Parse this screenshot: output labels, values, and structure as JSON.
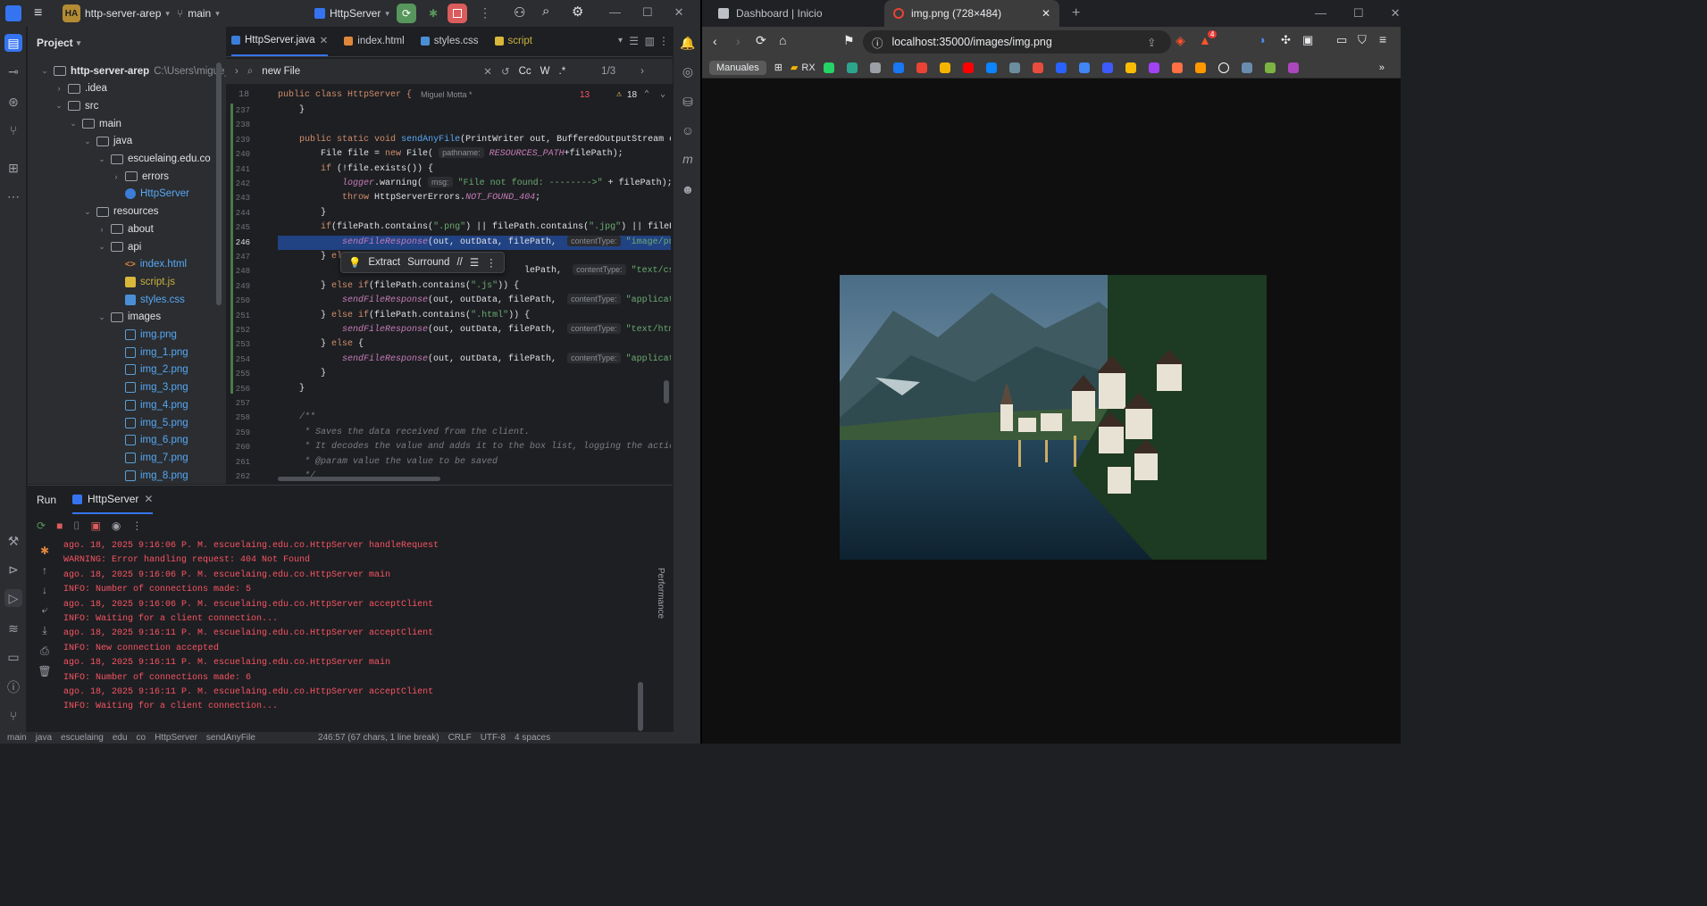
{
  "ide": {
    "project_badge": "HA",
    "project_name": "http-server-arep",
    "branch": "main",
    "run_config": "HttpServer",
    "project_panel_title": "Project",
    "tree": [
      {
        "label": "http-server-arep",
        "suffix": "C:\\Users\\migue_7m",
        "indent": 0,
        "kind": "folder",
        "open": true
      },
      {
        "label": ".idea",
        "indent": 1,
        "kind": "folder",
        "open": false
      },
      {
        "label": "src",
        "indent": 1,
        "kind": "folder",
        "open": true
      },
      {
        "label": "main",
        "indent": 2,
        "kind": "folder",
        "open": true
      },
      {
        "label": "java",
        "indent": 3,
        "kind": "folder",
        "open": true
      },
      {
        "label": "escuelaing.edu.co",
        "indent": 4,
        "kind": "folder",
        "open": true
      },
      {
        "label": "errors",
        "indent": 5,
        "kind": "folder",
        "open": false
      },
      {
        "label": "HttpServer",
        "indent": 5,
        "kind": "java"
      },
      {
        "label": "resources",
        "indent": 3,
        "kind": "folder",
        "open": true
      },
      {
        "label": "about",
        "indent": 4,
        "kind": "folder",
        "open": false
      },
      {
        "label": "api",
        "indent": 4,
        "kind": "folder",
        "open": true
      },
      {
        "label": "index.html",
        "indent": 5,
        "kind": "html"
      },
      {
        "label": "script.js",
        "indent": 5,
        "kind": "js"
      },
      {
        "label": "styles.css",
        "indent": 5,
        "kind": "css"
      },
      {
        "label": "images",
        "indent": 4,
        "kind": "folder",
        "open": true
      },
      {
        "label": "img.png",
        "indent": 5,
        "kind": "img"
      },
      {
        "label": "img_1.png",
        "indent": 5,
        "kind": "img"
      },
      {
        "label": "img_2.png",
        "indent": 5,
        "kind": "img"
      },
      {
        "label": "img_3.png",
        "indent": 5,
        "kind": "img"
      },
      {
        "label": "img_4.png",
        "indent": 5,
        "kind": "img"
      },
      {
        "label": "img_5.png",
        "indent": 5,
        "kind": "img"
      },
      {
        "label": "img_6.png",
        "indent": 5,
        "kind": "img"
      },
      {
        "label": "img_7.png",
        "indent": 5,
        "kind": "img"
      },
      {
        "label": "img_8.png",
        "indent": 5,
        "kind": "img"
      }
    ],
    "tabs": [
      "HttpServer.java",
      "index.html",
      "styles.css",
      "script"
    ],
    "find": {
      "query": "new File",
      "match_case": "Cc",
      "words": "W",
      "regex": ".*",
      "count": "1/3"
    },
    "sticky_line": "18",
    "sticky_code": "public class HttpServer {",
    "sticky_author": "Miguel Motta *",
    "errors": "13",
    "warnings": "18",
    "code_lines": [
      {
        "n": "237",
        "html": "    }"
      },
      {
        "n": "238",
        "html": ""
      },
      {
        "n": "239",
        "html": "    <span class='kw'>public static void</span> <span class='fn'>sendAnyFile</span>(PrintWriter out, BufferedOutputStream ou"
      },
      {
        "n": "240",
        "html": "        File file = <span class='kw'>new</span> File( <span class='hint'>pathname:</span> <span class='it2'>RESOURCES_PATH</span>+filePath);"
      },
      {
        "n": "241",
        "html": "        <span class='kw'>if</span> (!file.exists()) {"
      },
      {
        "n": "242",
        "html": "            <span class='it2'>logger</span>.warning( <span class='hint'>msg:</span> <span class='st'>\"File not found: -------->\"</span> + filePath);"
      },
      {
        "n": "243",
        "html": "            <span class='kw'>throw</span> HttpServerErrors.<span class='it2'>NOT_FOUND_404</span>;"
      },
      {
        "n": "244",
        "html": "        }"
      },
      {
        "n": "245",
        "html": "        <span class='kw'>if</span>(filePath.contains(<span class='st'>\".png\"</span>) || filePath.contains(<span class='st'>\".jpg\"</span>) || filePat"
      },
      {
        "n": "246",
        "html": "            <span class='it2'>sendFileResponse</span>(out, outData, filePath,  <span class='hint'>contentType:</span> <span class='st'>\"image/png\"</span>)",
        "sel": true
      },
      {
        "n": "247",
        "html": "        } <span class='kw'>el</span>"
      },
      {
        "n": "248",
        "html": "                                              lePath,  <span class='hint'>contentType:</span> <span class='st'>\"text/css\"</span>);"
      },
      {
        "n": "249",
        "html": "        } <span class='kw'>else if</span>(filePath.contains(<span class='st'>\".js\"</span>)) {"
      },
      {
        "n": "250",
        "html": "            <span class='it2'>sendFileResponse</span>(out, outData, filePath,  <span class='hint'>contentType:</span> <span class='st'>\"applicatio</span>"
      },
      {
        "n": "251",
        "html": "        } <span class='kw'>else if</span>(filePath.contains(<span class='st'>\".html\"</span>)) {"
      },
      {
        "n": "252",
        "html": "            <span class='it2'>sendFileResponse</span>(out, outData, filePath,  <span class='hint'>contentType:</span> <span class='st'>\"text/html\"</span>)"
      },
      {
        "n": "253",
        "html": "        } <span class='kw'>else</span> {"
      },
      {
        "n": "254",
        "html": "            <span class='it2'>sendFileResponse</span>(out, outData, filePath,  <span class='hint'>contentType:</span> <span class='st'>\"applicatio</span>"
      },
      {
        "n": "255",
        "html": "        }"
      },
      {
        "n": "256",
        "html": "    }"
      },
      {
        "n": "257",
        "html": ""
      },
      {
        "n": "258",
        "html": "    <span class='cm'>/**</span>"
      },
      {
        "n": "259",
        "html": "<span class='cm'>     * Saves the data received from the client.</span>"
      },
      {
        "n": "260",
        "html": "<span class='cm'>     * It decodes the value and adds it to the box list, logging the action.</span>"
      },
      {
        "n": "261",
        "html": "<span class='cm'>     * @param value the value to be saved</span>"
      },
      {
        "n": "262",
        "html": "<span class='cm'>     */</span>"
      }
    ],
    "popup": {
      "extract": "Extract",
      "surround": "Surround",
      "comment": "//"
    },
    "run_tab": "Run",
    "run_config_tab": "HttpServer",
    "console": [
      "ago. 18, 2025 9:16:06 P. M. escuelaing.edu.co.HttpServer handleRequest",
      "WARNING: Error handling request: 404 Not Found",
      "ago. 18, 2025 9:16:06 P. M. escuelaing.edu.co.HttpServer main",
      "INFO: Number of connections made: 5",
      "ago. 18, 2025 9:16:06 P. M. escuelaing.edu.co.HttpServer acceptClient",
      "INFO: Waiting for a client connection...",
      "ago. 18, 2025 9:16:11 P. M. escuelaing.edu.co.HttpServer acceptClient",
      "INFO: New connection accepted",
      "ago. 18, 2025 9:16:11 P. M. escuelaing.edu.co.HttpServer main",
      "INFO: Number of connections made: 6",
      "ago. 18, 2025 9:16:11 P. M. escuelaing.edu.co.HttpServer acceptClient",
      "INFO: Waiting for a client connection..."
    ],
    "performance_label": "Performance",
    "status": [
      "main",
      "java",
      "escuelaing",
      "edu",
      "co",
      "HttpServer",
      "sendAnyFile",
      "246:57 (67 chars, 1 line break)",
      "CRLF",
      "UTF-8",
      "4 spaces"
    ]
  },
  "browser": {
    "tab1": "Dashboard | Inicio",
    "tab2": "img.png (728×484)",
    "url": "localhost:35000/images/img.png",
    "bookmark_label": "Manuales",
    "bookmark_folder": "RX",
    "bookmark_colors": [
      "#25d366",
      "#2ca58d",
      "#9aa0a6",
      "#1877f2",
      "#ea4335",
      "#f4b400",
      "#ff0000",
      "#0a84ff",
      "#6b8e9f",
      "#e84c3d",
      "#2962ff",
      "#4285f4",
      "#3d5afe",
      "#fbbc05",
      "#a142f4",
      "#ff7043",
      "#ff9800",
      "#ffffff",
      "#6a8caf",
      "#7cb342",
      "#ab47bc"
    ],
    "brave_badge": "4"
  }
}
